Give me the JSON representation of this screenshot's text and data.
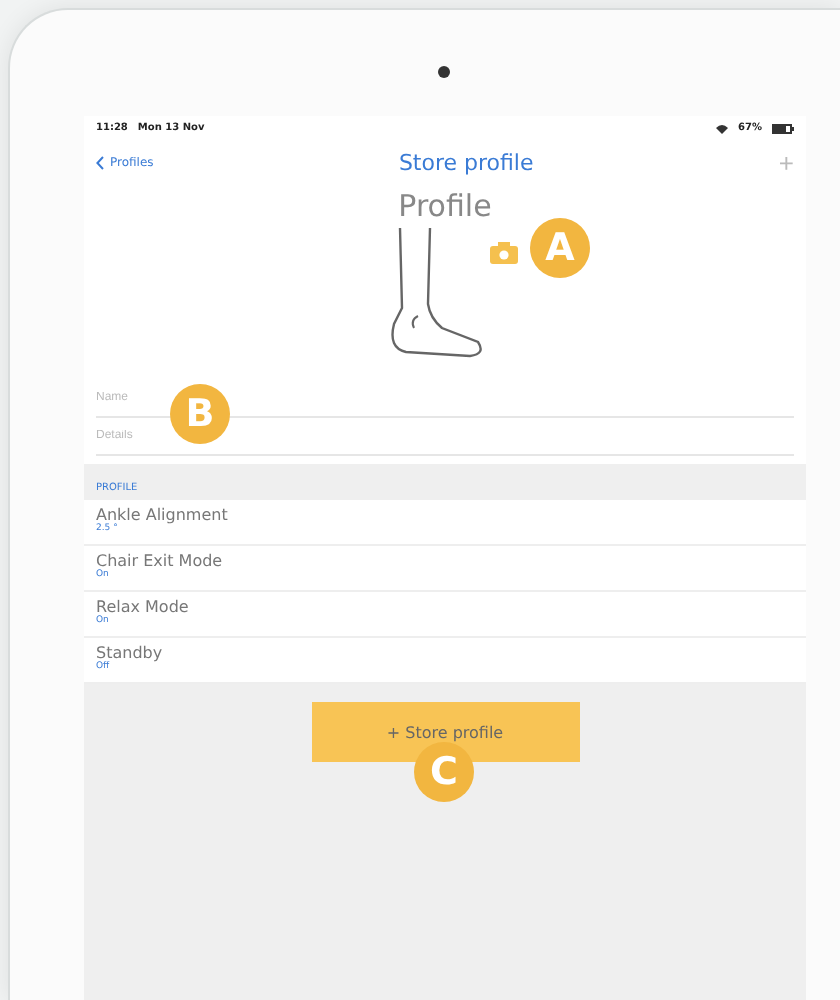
{
  "status_bar": {
    "time": "11:28",
    "date": "Mon 13 Nov",
    "battery": "67%"
  },
  "nav": {
    "back": "Profiles",
    "title": "Store profile",
    "add": "+"
  },
  "header": {
    "title": "Profile"
  },
  "fields": [
    {
      "placeholder": "Name"
    },
    {
      "placeholder": "Details"
    }
  ],
  "section": {
    "title": "PROFILE"
  },
  "settings": [
    {
      "label": "Ankle Alignment",
      "value": "2.5 °"
    },
    {
      "label": "Chair Exit Mode",
      "value": "On"
    },
    {
      "label": "Relax Mode",
      "value": "On"
    },
    {
      "label": "Standby",
      "value": "Off"
    }
  ],
  "button": {
    "icon": "+",
    "label": "Store profile"
  },
  "callouts": [
    {
      "letter": "A"
    },
    {
      "letter": "B"
    },
    {
      "letter": "C"
    }
  ]
}
